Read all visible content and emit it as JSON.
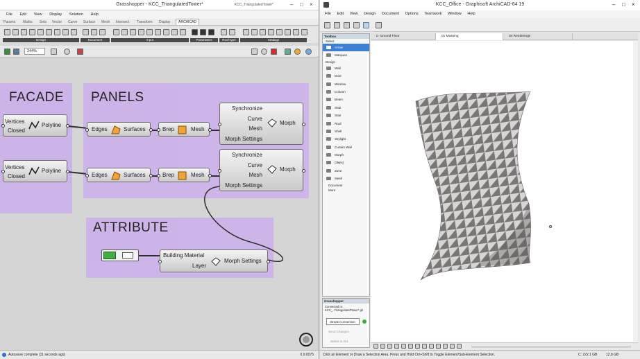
{
  "grasshopper": {
    "title": "Grasshopper - KCC_TriangulatedTower*",
    "doc_name": "KCC_TriangulatedTower*",
    "menu": [
      "File",
      "Edit",
      "View",
      "Display",
      "Solution",
      "Help"
    ],
    "tabs": [
      "Params",
      "Maths",
      "Sets",
      "Vector",
      "Curve",
      "Surface",
      "Mesh",
      "Intersect",
      "Transform",
      "Display",
      "ARCHICAD"
    ],
    "active_tab": "ARCHICAD",
    "categories": [
      "Design",
      "Document",
      "Input",
      "Parameters",
      "Roof-type",
      "Settings"
    ],
    "zoom": "244%",
    "groups": {
      "facade": "FACADE",
      "panels": "PANELS",
      "attribute": "ATTRIBUTE"
    },
    "components": {
      "polyline1": {
        "in": [
          "Vertices",
          "Closed"
        ],
        "out": "Polyline"
      },
      "polyline2": {
        "in": [
          "Vertices",
          "Closed"
        ],
        "out": "Polyline"
      },
      "surfaces1": {
        "in": "Edges",
        "out": "Surfaces"
      },
      "surfaces2": {
        "in": "Edges",
        "out": "Surfaces"
      },
      "mesh1": {
        "in": "Brep",
        "out": "Mesh"
      },
      "mesh2": {
        "in": "Brep",
        "out": "Mesh"
      },
      "morph1": {
        "in": [
          "Synchronize",
          "Curve",
          "Mesh",
          "Morph Settings"
        ],
        "out": "Morph"
      },
      "morph2": {
        "in": [
          "Synchronize",
          "Curve",
          "Mesh",
          "Morph Settings"
        ],
        "out": "Morph"
      },
      "morph_settings": {
        "in": [
          "Building Material",
          "Layer"
        ],
        "out": "Morph Settings"
      }
    },
    "status": "Autosave complete (11 seconds ago)",
    "version": "0.9.0076"
  },
  "archicad": {
    "title": "KCC_Office - Graphisoft ArchiCAD-64 19",
    "menu": [
      "File",
      "Edit",
      "View",
      "Design",
      "Document",
      "Options",
      "Teamwork",
      "Window",
      "Help"
    ],
    "toolbox": {
      "header": "Toolbox",
      "select_label": "Select",
      "items": [
        "Arrow",
        "Marquee"
      ],
      "design_label": "Design",
      "design_items": [
        "Wall",
        "Door",
        "Window",
        "Column",
        "Beam",
        "Slab",
        "Stair",
        "Roof",
        "Shell",
        "Skylight",
        "Curtain Wall",
        "Morph",
        "Object",
        "Zone",
        "Mesh"
      ],
      "groups": [
        "Document",
        "More"
      ]
    },
    "view_tabs": [
      "0. Ground Floor",
      "01 Massing",
      "04 Renderings"
    ],
    "gh_panel": {
      "title": "Grasshopper",
      "connected_label": "Connected to:",
      "connected_file": "KCC_..TriangulatedTower*.gh",
      "break_button": "Break Connection",
      "send_button": "Send Changes",
      "select_button": "Select in GH"
    },
    "status": "Click an Element or Draw a Selection Area. Press and Hold Ctrl+Shift to Toggle Element/Sub-Element Selection.",
    "disk": "C: 222.1 GB",
    "ram": "12.8 GB",
    "colors": {
      "tower_face_light": "#b8b4b4",
      "tower_face_dark": "#6f6b6b",
      "group_purple": "#cdb3ea",
      "selection_blue": "#3b7fd6"
    }
  }
}
